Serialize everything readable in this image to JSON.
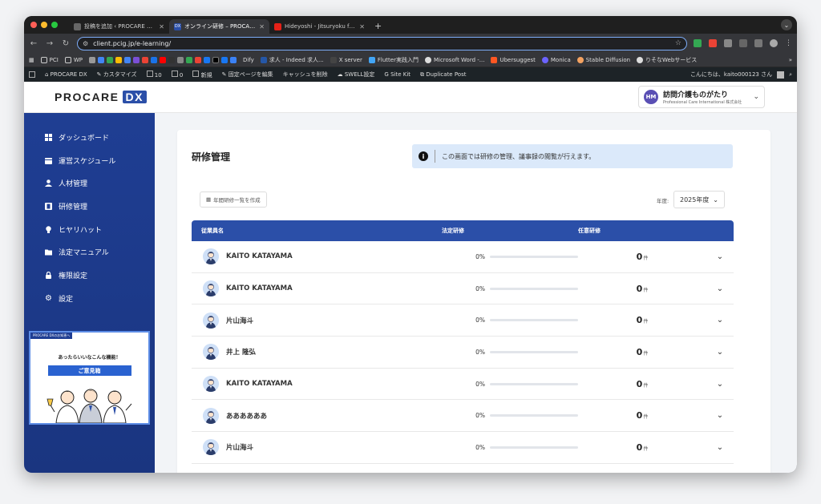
{
  "browser": {
    "tabs": [
      {
        "title": "投稿を追加 ‹ PROCARE DX — WordPress",
        "active": false,
        "fav_color": "#666"
      },
      {
        "title": "オンライン研修 – PROCARE DX",
        "active": true,
        "fav_color": "#2b4fa8",
        "fav_text": "DX"
      },
      {
        "title": "Hideyoshi - Jitsuryoku feat.",
        "active": false,
        "fav_color": "#e62117"
      }
    ],
    "new_tab": "+",
    "url": "client.pcig.jp/e-learning/",
    "bookmarks": [
      "PCI",
      "WP",
      "Dify",
      "求人 - Indeed 求人...",
      "X server",
      "Flutter実践入門",
      "Microsoft Word -...",
      "Ubersuggest",
      "Monica",
      "Stable Diffusion",
      "りそなWebサービス"
    ],
    "more": "»"
  },
  "wpbar": {
    "items": [
      "PROCARE DX",
      "カスタマイズ",
      "10",
      "0",
      "新規",
      "固定ページを編集",
      "キャッシュを削除",
      "SWELL設定",
      "Site Kit",
      "Duplicate Post"
    ],
    "greeting": "こんにちは、kaito000123 さん"
  },
  "header": {
    "logo_text": "PROCARE",
    "logo_badge": "DX",
    "company_initials": "HM",
    "company_name": "訪問介護ものがたり",
    "company_sub": "Professional Care International 株式会社"
  },
  "sidebar": {
    "items": [
      {
        "label": "ダッシュボード",
        "icon": "grid-icon"
      },
      {
        "label": "運営スケジュール",
        "icon": "calendar-icon"
      },
      {
        "label": "人材管理",
        "icon": "person-icon"
      },
      {
        "label": "研修管理",
        "icon": "film-icon"
      },
      {
        "label": "ヒヤリハット",
        "icon": "bulb-icon"
      },
      {
        "label": "法定マニュアル",
        "icon": "folder-icon"
      },
      {
        "label": "権限設定",
        "icon": "lock-icon"
      },
      {
        "label": "設定",
        "icon": "gear-icon"
      }
    ],
    "promo": {
      "tag": "PROCARE DXのお知恵へ",
      "headline": "あったらいいなこんな機能！",
      "button": "ご意見箱"
    }
  },
  "main": {
    "title": "研修管理",
    "info": "この画面では研修の管理、議事録の閲覧が行えます。",
    "create_button": "年間研修一覧を作成",
    "year_label": "年度:",
    "year_value": "2025年度",
    "columns": [
      "従業員名",
      "法定研修",
      "任意研修"
    ],
    "unit": "件",
    "rows": [
      {
        "name": "KAITO KATAYAMA",
        "mandatory_pct": "0%",
        "progress": 0,
        "optional": "0"
      },
      {
        "name": "KAITO KATAYAMA",
        "mandatory_pct": "0%",
        "progress": 0,
        "optional": "0"
      },
      {
        "name": "片山海斗",
        "mandatory_pct": "0%",
        "progress": 0,
        "optional": "0"
      },
      {
        "name": "井上 隆弘",
        "mandatory_pct": "0%",
        "progress": 0,
        "optional": "0"
      },
      {
        "name": "KAITO KATAYAMA",
        "mandatory_pct": "0%",
        "progress": 0,
        "optional": "0"
      },
      {
        "name": "ああああああ",
        "mandatory_pct": "0%",
        "progress": 0,
        "optional": "0"
      },
      {
        "name": "片山海斗",
        "mandatory_pct": "0%",
        "progress": 0,
        "optional": "0"
      }
    ]
  },
  "colors": {
    "brand": "#2b4fa8",
    "sidebar": "#1f3e93",
    "info_bg": "#dbe9fa"
  }
}
